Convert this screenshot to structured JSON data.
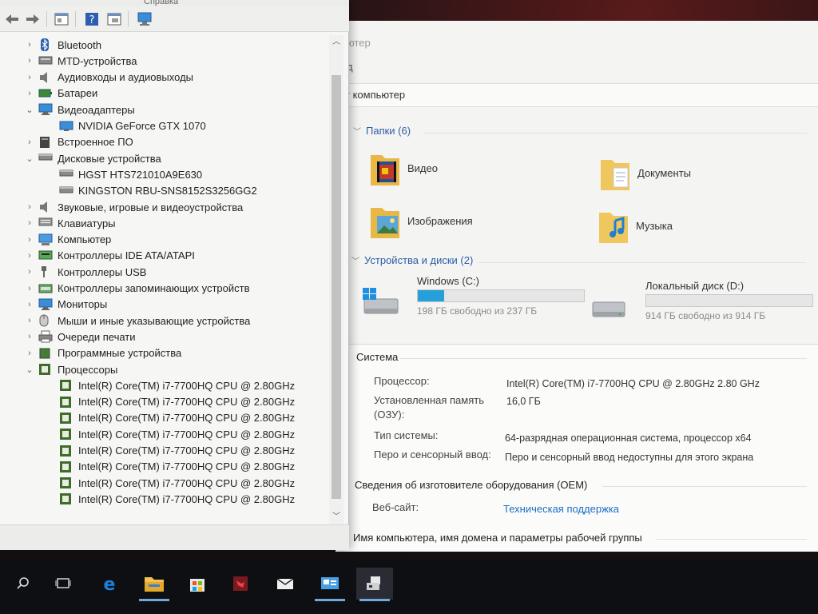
{
  "device_manager": {
    "menu_fragment": "Справка",
    "tree": [
      {
        "label": "Bluetooth",
        "icon": "bluetooth-icon",
        "expanded": false,
        "level": 1
      },
      {
        "label": "MTD-устройства",
        "icon": "mtd-device-icon",
        "expanded": false,
        "level": 1
      },
      {
        "label": "Аудиовходы и аудиовыходы",
        "icon": "speaker-icon",
        "expanded": false,
        "level": 1
      },
      {
        "label": "Батареи",
        "icon": "battery-icon",
        "expanded": false,
        "level": 1
      },
      {
        "label": "Видеоадаптеры",
        "icon": "monitor-icon",
        "expanded": true,
        "level": 1
      },
      {
        "label": "NVIDIA GeForce GTX 1070",
        "icon": "display-adapter-icon",
        "level": 2
      },
      {
        "label": "Встроенное ПО",
        "icon": "firmware-icon",
        "expanded": false,
        "level": 1
      },
      {
        "label": "Дисковые устройства",
        "icon": "disk-icon",
        "expanded": true,
        "level": 1
      },
      {
        "label": "HGST HTS721010A9E630",
        "icon": "disk-icon",
        "level": 2
      },
      {
        "label": "KINGSTON RBU-SNS8152S3256GG2",
        "icon": "disk-icon",
        "level": 2
      },
      {
        "label": "Звуковые, игровые и видеоустройства",
        "icon": "speaker-icon",
        "expanded": false,
        "level": 1
      },
      {
        "label": "Клавиатуры",
        "icon": "keyboard-icon",
        "expanded": false,
        "level": 1
      },
      {
        "label": "Компьютер",
        "icon": "computer-icon",
        "expanded": false,
        "level": 1
      },
      {
        "label": "Контроллеры IDE ATA/ATAPI",
        "icon": "ide-controller-icon",
        "expanded": false,
        "level": 1
      },
      {
        "label": "Контроллеры USB",
        "icon": "usb-icon",
        "expanded": false,
        "level": 1
      },
      {
        "label": "Контроллеры запоминающих устройств",
        "icon": "storage-controller-icon",
        "expanded": false,
        "level": 1
      },
      {
        "label": "Мониторы",
        "icon": "monitor-icon",
        "expanded": false,
        "level": 1
      },
      {
        "label": "Мыши и иные указывающие устройства",
        "icon": "mouse-icon",
        "expanded": false,
        "level": 1
      },
      {
        "label": "Очереди печати",
        "icon": "printer-icon",
        "expanded": false,
        "level": 1
      },
      {
        "label": "Программные устройства",
        "icon": "software-device-icon",
        "expanded": false,
        "level": 1
      },
      {
        "label": "Процессоры",
        "icon": "processor-icon",
        "expanded": true,
        "level": 1
      },
      {
        "label": "Intel(R) Core(TM) i7-7700HQ CPU @ 2.80GHz",
        "icon": "processor-icon",
        "level": 2
      },
      {
        "label": "Intel(R) Core(TM) i7-7700HQ CPU @ 2.80GHz",
        "icon": "processor-icon",
        "level": 2
      },
      {
        "label": "Intel(R) Core(TM) i7-7700HQ CPU @ 2.80GHz",
        "icon": "processor-icon",
        "level": 2
      },
      {
        "label": "Intel(R) Core(TM) i7-7700HQ CPU @ 2.80GHz",
        "icon": "processor-icon",
        "level": 2
      },
      {
        "label": "Intel(R) Core(TM) i7-7700HQ CPU @ 2.80GHz",
        "icon": "processor-icon",
        "level": 2
      },
      {
        "label": "Intel(R) Core(TM) i7-7700HQ CPU @ 2.80GHz",
        "icon": "processor-icon",
        "level": 2
      },
      {
        "label": "Intel(R) Core(TM) i7-7700HQ CPU @ 2.80GHz",
        "icon": "processor-icon",
        "level": 2
      },
      {
        "label": "Intel(R) Core(TM) i7-7700HQ CPU @ 2.80GHz",
        "icon": "processor-icon",
        "level": 2
      }
    ]
  },
  "explorer": {
    "title_fragment": "ютер",
    "ribbon_fragment": "д",
    "address_fragment": "т компьютер",
    "folders_group": "Папки (6)",
    "folders": [
      {
        "label": "Видео",
        "icon": "video-folder-icon"
      },
      {
        "label": "Документы",
        "icon": "documents-folder-icon"
      },
      {
        "label": "Изображения",
        "icon": "pictures-folder-icon"
      },
      {
        "label": "Музыка",
        "icon": "music-folder-icon"
      }
    ],
    "drives_group": "Устройства и диски (2)",
    "drives": [
      {
        "label": "Windows (C:)",
        "free_text": "198 ГБ свободно из 237 ГБ",
        "used_fraction": 0.16,
        "icon": "windows-drive-icon"
      },
      {
        "label": "Локальный диск (D:)",
        "free_text": "914 ГБ свободно из 914 ГБ",
        "used_fraction": 0.0,
        "icon": "hard-drive-icon"
      }
    ]
  },
  "system": {
    "heading": "Система",
    "processor_label": "Процессор:",
    "processor_value": "Intel(R) Core(TM) i7-7700HQ CPU @ 2.80GHz   2.80 GHz",
    "memory_label_1": "Установленная память",
    "memory_label_2": "(ОЗУ):",
    "memory_value": "16,0 ГБ",
    "type_label": "Тип системы:",
    "type_value": "64-разрядная операционная система, процессор x64",
    "pen_label": "Перо и сенсорный ввод:",
    "pen_value": "Перо и сенсорный ввод недоступны для этого экрана",
    "oem_heading": "Сведения об изготовителе оборудования (OEM)",
    "website_label": "Веб-сайт:",
    "website_link": "Техническая поддержка",
    "computer_name_heading": "Имя компьютера, имя домена и параметры рабочей группы"
  },
  "taskbar": {
    "items": [
      {
        "name": "search-icon"
      },
      {
        "name": "task-view-icon"
      },
      {
        "name": "edge-icon"
      },
      {
        "name": "file-explorer-icon"
      },
      {
        "name": "store-icon"
      },
      {
        "name": "app-red-icon"
      },
      {
        "name": "mail-icon"
      },
      {
        "name": "system-info-icon"
      },
      {
        "name": "device-manager-icon"
      }
    ]
  },
  "colors": {
    "accent": "#26a0da",
    "link": "#1a6fc4",
    "group_heading": "#2b5ea8",
    "taskbar": "#0e0f13"
  }
}
